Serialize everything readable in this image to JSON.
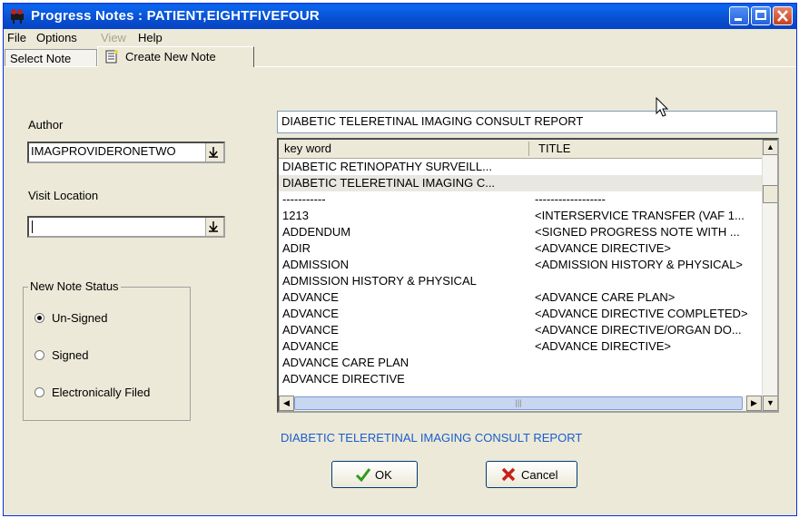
{
  "window": {
    "title": "Progress Notes : PATIENT,EIGHTFIVEFOUR"
  },
  "menu": {
    "file": "File",
    "options": "Options",
    "view": "View",
    "help": "Help"
  },
  "tabs": {
    "select_note": "Select Note",
    "create_new_note": "Create New Note"
  },
  "author": {
    "label": "Author",
    "value": "IMAGPROVIDERONETWO"
  },
  "visit_location": {
    "label": "Visit Location",
    "value": ""
  },
  "note_status": {
    "legend": "New Note Status",
    "options": [
      "Un-Signed",
      "Signed",
      "Electronically Filed"
    ],
    "selected": "Un-Signed"
  },
  "search": {
    "value": "DIABETIC TELERETINAL IMAGING CONSULT REPORT"
  },
  "list": {
    "headers": [
      "key word",
      "TITLE"
    ],
    "rows": [
      [
        "DIABETIC RETINOPATHY SURVEILL...",
        ""
      ],
      [
        "DIABETIC TELERETINAL IMAGING C...",
        ""
      ],
      [
        "-----------",
        "------------------"
      ],
      [
        "1213",
        "<INTERSERVICE TRANSFER (VAF 1..."
      ],
      [
        "ADDENDUM",
        "<SIGNED PROGRESS NOTE WITH ..."
      ],
      [
        "ADIR",
        "<ADVANCE DIRECTIVE>"
      ],
      [
        "ADMISSION",
        "<ADMISSION HISTORY & PHYSICAL>"
      ],
      [
        "ADMISSION HISTORY & PHYSICAL",
        ""
      ],
      [
        "ADVANCE",
        "<ADVANCE CARE PLAN>"
      ],
      [
        "ADVANCE",
        "<ADVANCE DIRECTIVE COMPLETED>"
      ],
      [
        "ADVANCE",
        "<ADVANCE DIRECTIVE/ORGAN DO..."
      ],
      [
        "ADVANCE",
        "<ADVANCE DIRECTIVE>"
      ],
      [
        "ADVANCE CARE PLAN",
        ""
      ],
      [
        "ADVANCE DIRECTIVE",
        ""
      ]
    ],
    "selected_index": 1
  },
  "selected_title": "DIABETIC TELERETINAL IMAGING CONSULT REPORT",
  "buttons": {
    "ok": "OK",
    "cancel": "Cancel"
  },
  "colors": {
    "title_bar": "#0a5ee8",
    "accent_text": "#1a5dcc",
    "ok_check": "#2e9a1c",
    "cancel_x": "#c8201a"
  },
  "icons": {
    "app": "film-camera-icon",
    "create_tab": "notepad-icon",
    "ok": "checkmark-icon",
    "cancel": "x-mark-icon"
  }
}
